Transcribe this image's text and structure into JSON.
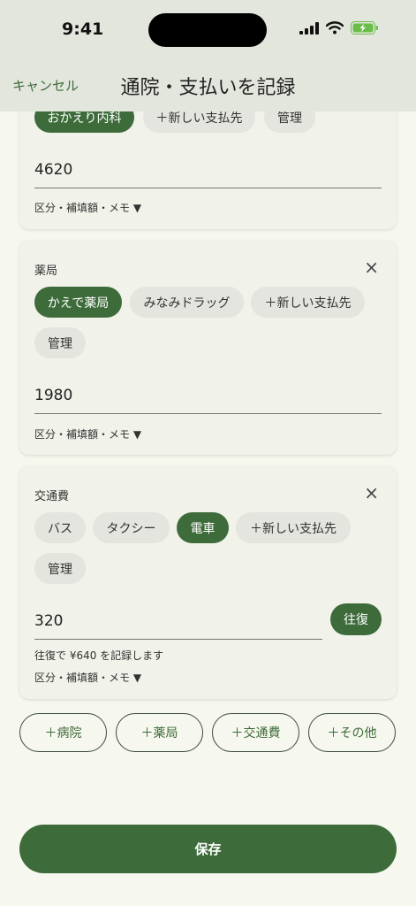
{
  "status": {
    "time": "9:41"
  },
  "nav": {
    "cancel": "キャンセル",
    "title": "通院・支払いを記録"
  },
  "hospital_card": {
    "chips": [
      "おかえり内科",
      "＋新しい支払先",
      "管理"
    ],
    "amount": "4620",
    "meta": "区分・補填額・メモ ▼"
  },
  "pharmacy_card": {
    "label": "薬局",
    "close": "×",
    "chips": [
      "かえで薬局",
      "みなみドラッグ",
      "＋新しい支払先",
      "管理"
    ],
    "amount": "1980",
    "meta": "区分・補填額・メモ ▼"
  },
  "transport_card": {
    "label": "交通費",
    "close": "×",
    "chips": [
      "バス",
      "タクシー",
      "電車",
      "＋新しい支払先",
      "管理"
    ],
    "amount": "320",
    "roundtrip": "往復",
    "note": "往復で ¥640 を記録します",
    "meta": "区分・補填額・メモ ▼"
  },
  "add_buttons": [
    "＋病院",
    "＋薬局",
    "＋交通費",
    "＋その他"
  ],
  "save": "保存",
  "colors": {
    "accent": "#3d6b3a",
    "header": "#e3e6dd",
    "background": "#f6f7ee",
    "card": "#f1f2ea",
    "chip": "#e4e5de"
  }
}
